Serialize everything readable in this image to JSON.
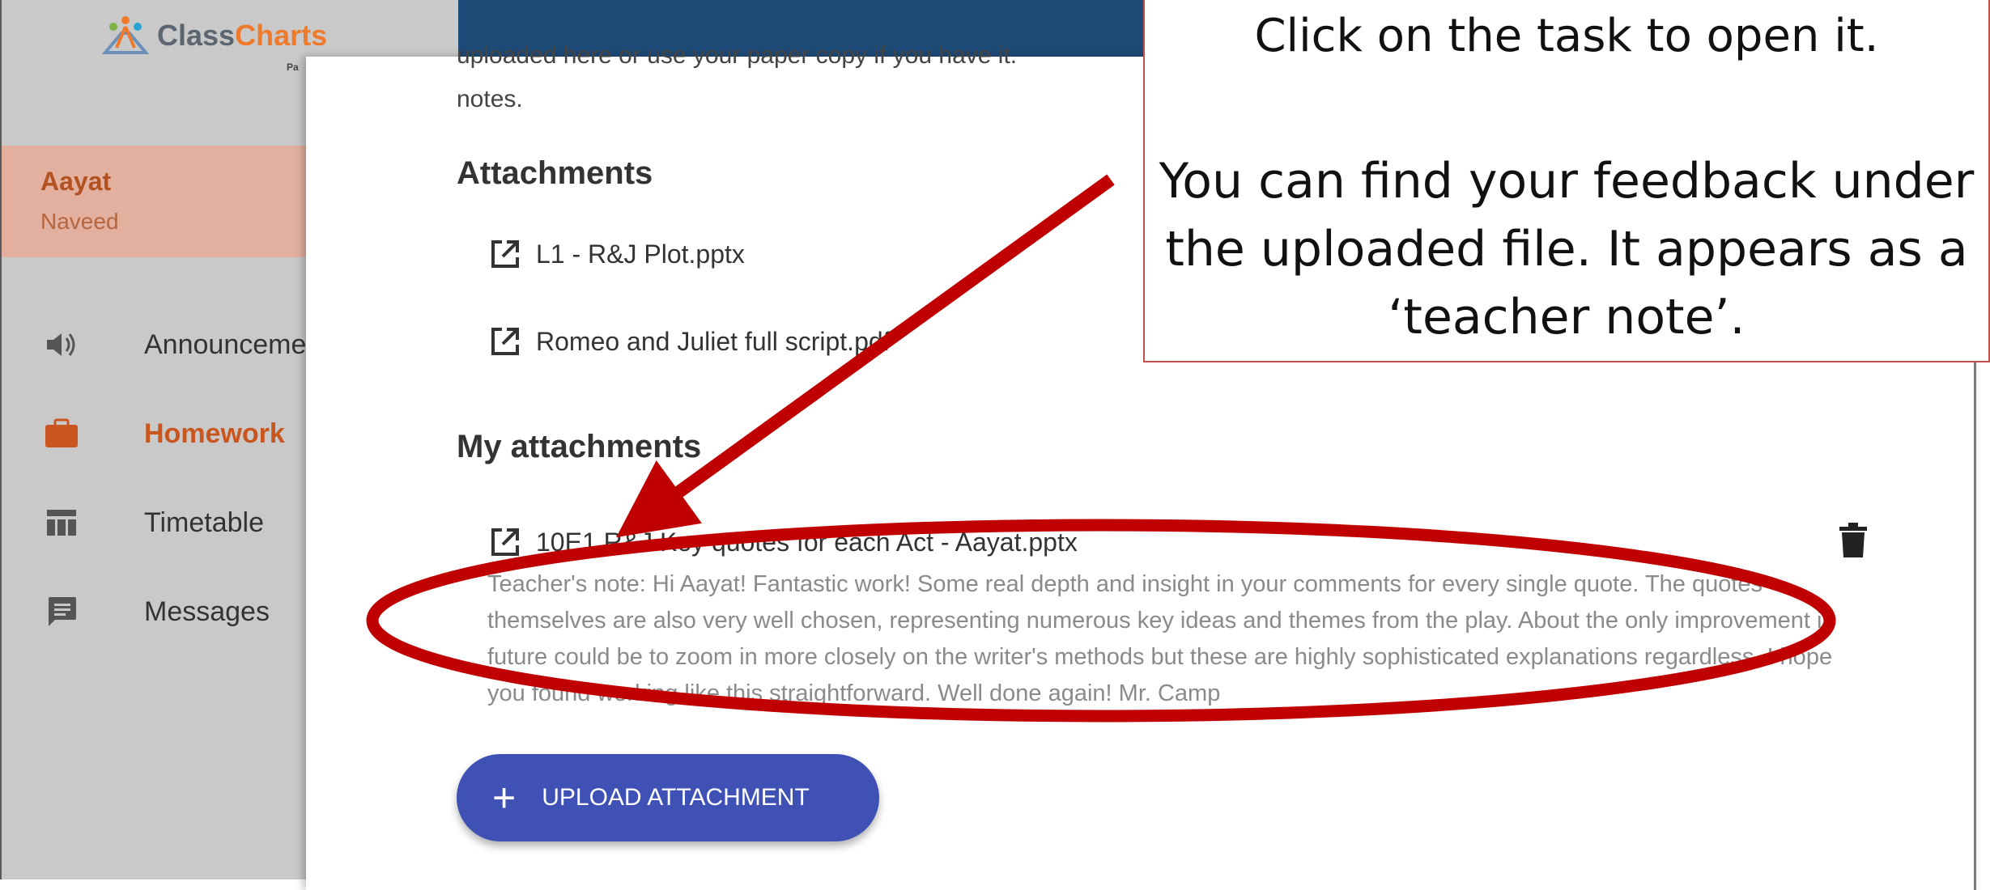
{
  "app": {
    "logo_part1": "Class",
    "logo_part2": "Charts",
    "logo_sub": "Pa"
  },
  "user": {
    "first_name": "Aayat",
    "last_name": "Naveed"
  },
  "sidebar": {
    "items": [
      {
        "label": "Announcements",
        "icon": "speaker-icon",
        "active": false
      },
      {
        "label": "Homework",
        "icon": "briefcase-icon",
        "active": true
      },
      {
        "label": "Timetable",
        "icon": "timetable-icon",
        "active": false
      },
      {
        "label": "Messages",
        "icon": "chat-icon",
        "active": false
      }
    ]
  },
  "task": {
    "description_cut": "uploaded here or use your paper copy if you have it.",
    "description_end": "notes.",
    "attachments_title": "Attachments",
    "attachments": [
      {
        "name": "L1 - R&J Plot.pptx"
      },
      {
        "name": "Romeo and Juliet full script.pdf"
      }
    ],
    "my_attachments_title": "My attachments",
    "my_attachments": [
      {
        "name": "10E1 R&J Key quotes for each Act - Aayat.pptx",
        "teacher_note": "Teacher's note: Hi Aayat! Fantastic work! Some real depth and insight in your comments for every single quote. The quotes themselves are also very well chosen, representing numerous key ideas and themes from the play. About the only improvement in future could be to zoom in more closely on the writer's methods but these are highly sophisticated explanations regardless. I hope you found working like this straightforward. Well done again! Mr. Camp"
      }
    ],
    "upload_button_label": "UPLOAD ATTACHMENT"
  },
  "annotation": {
    "line1": "Click on the task to open it.",
    "line2": "You can find your feedback under the uploaded file. It appears as a ‘teacher note’."
  },
  "colors": {
    "brand_orange": "#f07a2b",
    "header_blue": "#1e4a77",
    "button_indigo": "#3f51b5",
    "annotation_red": "#c00000"
  }
}
